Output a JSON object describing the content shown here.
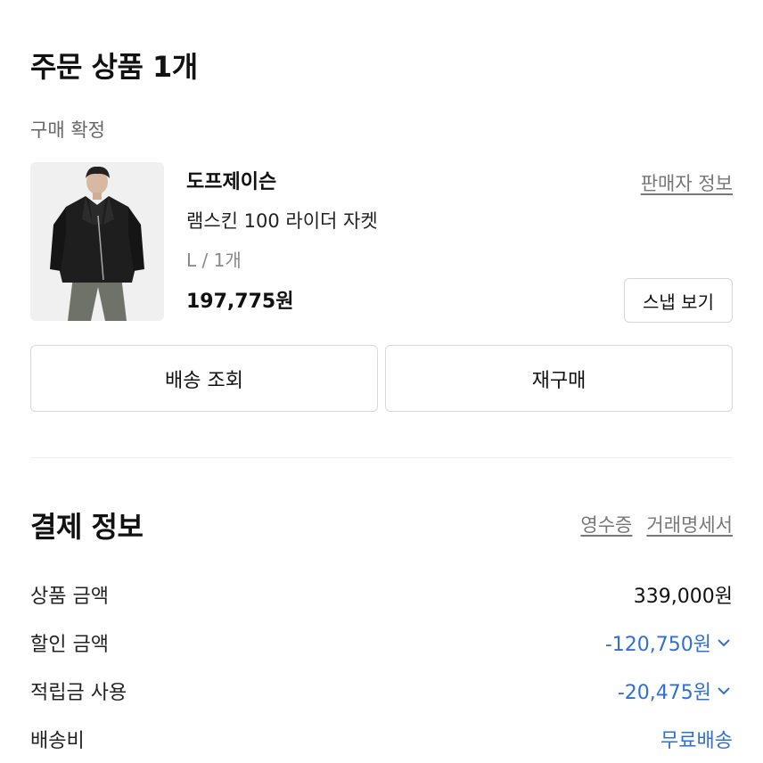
{
  "order": {
    "title": "주문 상품 1개",
    "status": "구매 확정",
    "seller_link": "판매자 정보",
    "brand": "도프제이슨",
    "product_name": "램스킨 100 라이더 자켓",
    "option": "L / 1개",
    "price": "197,775원",
    "snap_button": "스냅 보기",
    "actions": {
      "track": "배송 조회",
      "rebuy": "재구매"
    }
  },
  "payment": {
    "title": "결제 정보",
    "receipt_link": "영수증",
    "statement_link": "거래명세서",
    "rows": [
      {
        "label": "상품 금액",
        "value": "339,000원"
      },
      {
        "label": "할인 금액",
        "value": "-120,750원"
      },
      {
        "label": "적립금 사용",
        "value": "-20,475원"
      },
      {
        "label": "배송비",
        "value": "무료배송"
      }
    ]
  },
  "colors": {
    "accent_blue": "#2f6fd8",
    "muted_text": "#777777"
  },
  "icons": {
    "expand": "chevron-down-icon"
  }
}
